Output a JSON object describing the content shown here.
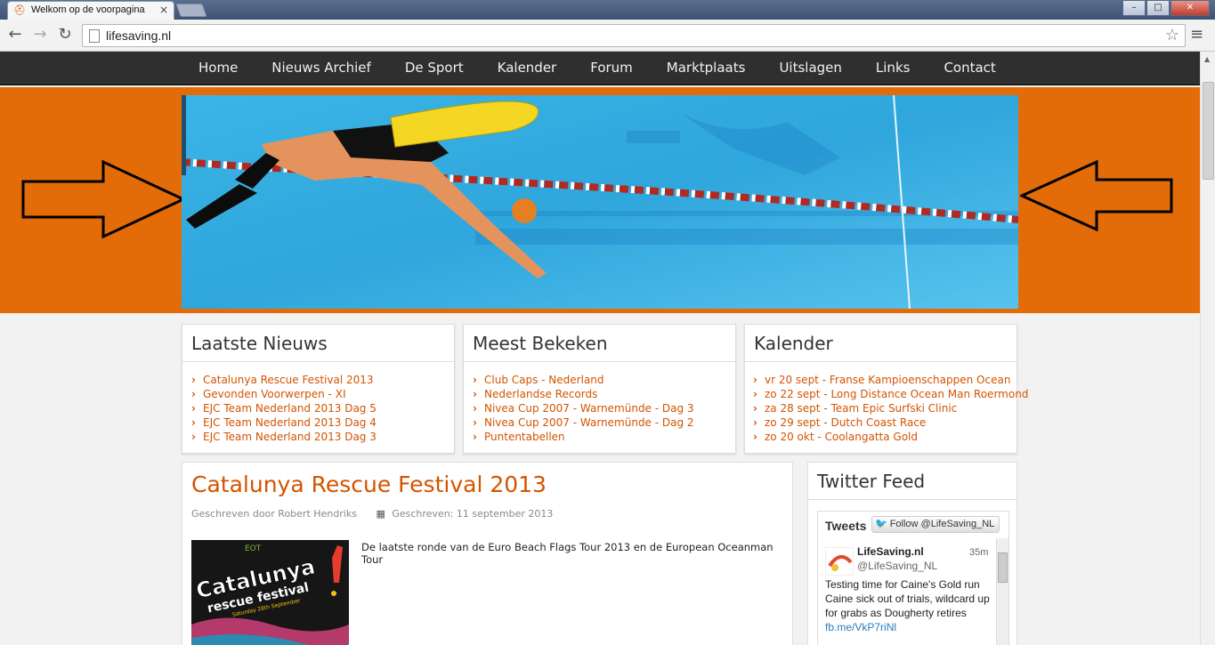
{
  "browser": {
    "tab_title": "Welkom op de voorpagina",
    "tab_close": "×",
    "url": "lifesaving.nl",
    "back_icon": "←",
    "forward_icon": "→",
    "reload_icon": "↻",
    "star_icon": "☆",
    "menu_icon": "≡",
    "win_minimize": "–",
    "win_maximize": "□",
    "win_close": "✕"
  },
  "nav": {
    "items": [
      "Home",
      "Nieuws Archief",
      "De Sport",
      "Kalender",
      "Forum",
      "Marktplaats",
      "Uitslagen",
      "Links",
      "Contact"
    ]
  },
  "colors": {
    "accent": "#e36c09",
    "link": "#d35400",
    "nav_bg": "#2f2f2f"
  },
  "news": {
    "title": "Laatste Nieuws",
    "items": [
      "Catalunya Rescue Festival 2013",
      "Gevonden Voorwerpen - XI",
      "EJC Team Nederland 2013 Dag 5",
      "EJC Team Nederland 2013 Dag 4",
      "EJC Team Nederland 2013 Dag 3"
    ]
  },
  "most_viewed": {
    "title": "Meest Bekeken",
    "items": [
      "Club Caps - Nederland",
      "Nederlandse Records",
      "Nivea Cup 2007 - Warnemünde - Dag 3",
      "Nivea Cup 2007 - Warnemünde - Dag 2",
      "Puntentabellen"
    ]
  },
  "calendar": {
    "title": "Kalender",
    "items": [
      "vr 20 sept - Franse Kampioenschappen Ocean",
      "zo 22 sept - Long Distance Ocean Man Roermond",
      "za 28 sept - Team Epic Surfski Clinic",
      "zo 29 sept - Dutch Coast Race",
      "zo 20 okt - Coolangatta Gold"
    ]
  },
  "article": {
    "title": "Catalunya Rescue Festival 2013",
    "author": "Geschreven door Robert Hendriks",
    "date": "Geschreven: 11 september 2013",
    "intro": "De laatste ronde van de Euro Beach Flags Tour 2013 en de European Oceanman Tour",
    "image_text_1": "Catalunya",
    "image_text_2": "rescue festival",
    "image_text_3": "Saturday 28th September",
    "image_text_4": "EOT"
  },
  "twitter": {
    "title": "Twitter Feed",
    "tweets_label": "Tweets",
    "follow_label": "Follow @LifeSaving_NL",
    "tweet": {
      "name": "LifeSaving.nl",
      "handle": "@LifeSaving_NL",
      "time": "35m",
      "line1": "Testing time for Caine's Gold run",
      "line2": "Caine sick out of trials, wildcard up for grabs as Dougherty retires",
      "link": "fb.me/VkP7riNl"
    }
  }
}
